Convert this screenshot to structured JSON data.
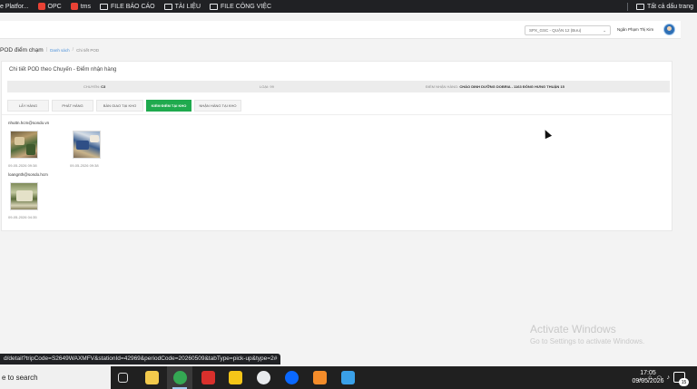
{
  "bookmarks": {
    "items": [
      {
        "label": "e Platfor...",
        "icon": "bookmark-icon"
      },
      {
        "label": "OPC",
        "icon": "brand-icon"
      },
      {
        "label": "tms",
        "icon": "brand-icon"
      },
      {
        "label": "FILE BÁO CÁO",
        "icon": "folder-icon"
      },
      {
        "label": "TÀI LIỆU",
        "icon": "folder-icon"
      },
      {
        "label": "FILE CÔNG VIỆC",
        "icon": "folder-icon"
      }
    ],
    "all_bookmarks": "Tất cả dấu trang"
  },
  "header": {
    "station_select": "SPX_GSC - QUẬN 12 (Bưu)",
    "user_name": "Ngân Phạm Thị Kim"
  },
  "breadcrumb": {
    "title": "POD điểm chạm",
    "link": "Danh sách",
    "current": "Chi tiết POD"
  },
  "card": {
    "title": "Chi tiết POD theo Chuyến - Điểm nhận hàng",
    "info": {
      "trip_label": "CHUYẾN:",
      "trip_value": "C3",
      "type_label": "LOẠI: 99",
      "point_label": "ĐIỂM NHẬN HÀNG:",
      "point_value": "CHÁO DINH DƯỠNG DOBRIA - 1163 ĐÔNG HƯNG THUẬN 15"
    },
    "tabs": [
      {
        "label": "LẤY HÀNG",
        "active": false
      },
      {
        "label": "PHÁT HÀNG",
        "active": false
      },
      {
        "label": "BÀN GIAO TẠI KHO",
        "active": false
      },
      {
        "label": "KIỂM ĐIẾM TẠI KHO",
        "active": true
      },
      {
        "label": "NHẬN HÀNG TẠI KHO",
        "active": false
      }
    ],
    "groups": [
      {
        "uploader": "nhuttn.hcm@sondo.vn",
        "photos": [
          {
            "time": "09-05-2026 09:38"
          },
          {
            "time": "09-05-2026 09:38"
          }
        ]
      },
      {
        "uploader": "loangnth@sondo.hcm",
        "photos": [
          {
            "time": "09-05-2026 04:35"
          }
        ]
      }
    ]
  },
  "watermark": {
    "title": "Activate Windows",
    "subtitle": "Go to Settings to activate Windows."
  },
  "status_url": "d/detail?tripCode=S2649WAXMFV&stationId=42969&periodCode=20260509&tabType=pick-up&type=2#",
  "taskbar": {
    "search_text": "e to search",
    "time": "17:05",
    "date": "09/05/2026",
    "notification_count": "15"
  }
}
